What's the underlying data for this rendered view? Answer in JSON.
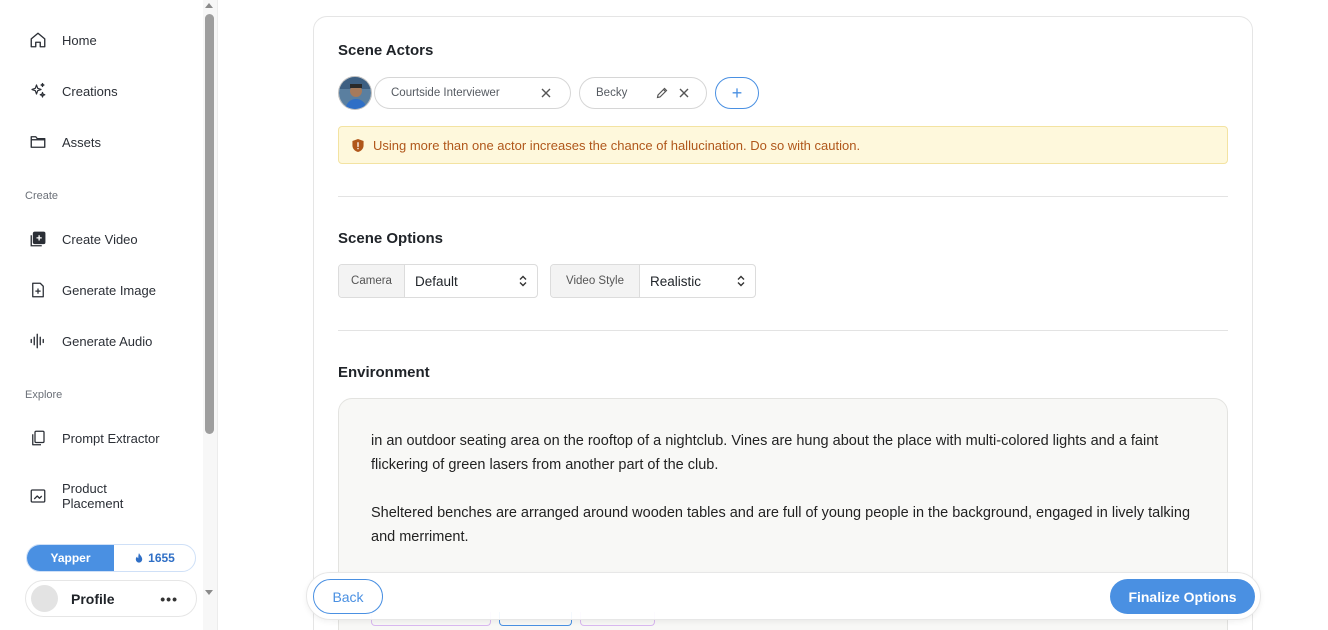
{
  "sidebar": {
    "nav": [
      {
        "label": "Home",
        "icon": "home-icon"
      },
      {
        "label": "Creations",
        "icon": "sparkles-icon"
      },
      {
        "label": "Assets",
        "icon": "folder-icon"
      }
    ],
    "create_label": "Create",
    "create_items": [
      {
        "label": "Create Video",
        "icon": "add-video-icon"
      },
      {
        "label": "Generate Image",
        "icon": "add-image-icon"
      },
      {
        "label": "Generate Audio",
        "icon": "audio-wave-icon"
      }
    ],
    "explore_label": "Explore",
    "explore_items": [
      {
        "label": "Prompt Extractor",
        "icon": "copy-icon"
      },
      {
        "label": "Product Placement",
        "icon": "image-frame-icon"
      }
    ],
    "plan": {
      "name": "Yapper",
      "credits": "1655",
      "credits_icon": "flame-icon"
    },
    "profile": {
      "name": "Profile",
      "more": "•••"
    }
  },
  "scene_actors": {
    "title": "Scene Actors",
    "actors": [
      {
        "name": "Courtside Interviewer",
        "actions": [
          "close-icon"
        ]
      },
      {
        "name": "Becky",
        "actions": [
          "pencil-icon",
          "close-icon"
        ]
      }
    ],
    "add_label": "+",
    "warning": "Using more than one actor increases the chance of hallucination. Do so with caution.",
    "warning_icon": "shield-alert-icon"
  },
  "scene_options": {
    "title": "Scene Options",
    "camera": {
      "label": "Camera",
      "value": "Default"
    },
    "video_style": {
      "label": "Video Style",
      "value": "Realistic"
    }
  },
  "environment": {
    "title": "Environment",
    "paragraphs": [
      "in an outdoor seating area on the rooftop of a nightclub. Vines are hung about the place with multi-colored lights and a faint flickering of green lasers from another part of the club.",
      "Sheltered benches are arranged around wooden tables and are full of young people in the background, engaged in lively talking and merriment."
    ]
  },
  "actions": {
    "back": "Back",
    "finalize": "Finalize Options"
  },
  "colors": {
    "accent": "#4a90e2",
    "warning_bg": "#fef8dc",
    "warning_text": "#b0571b"
  }
}
